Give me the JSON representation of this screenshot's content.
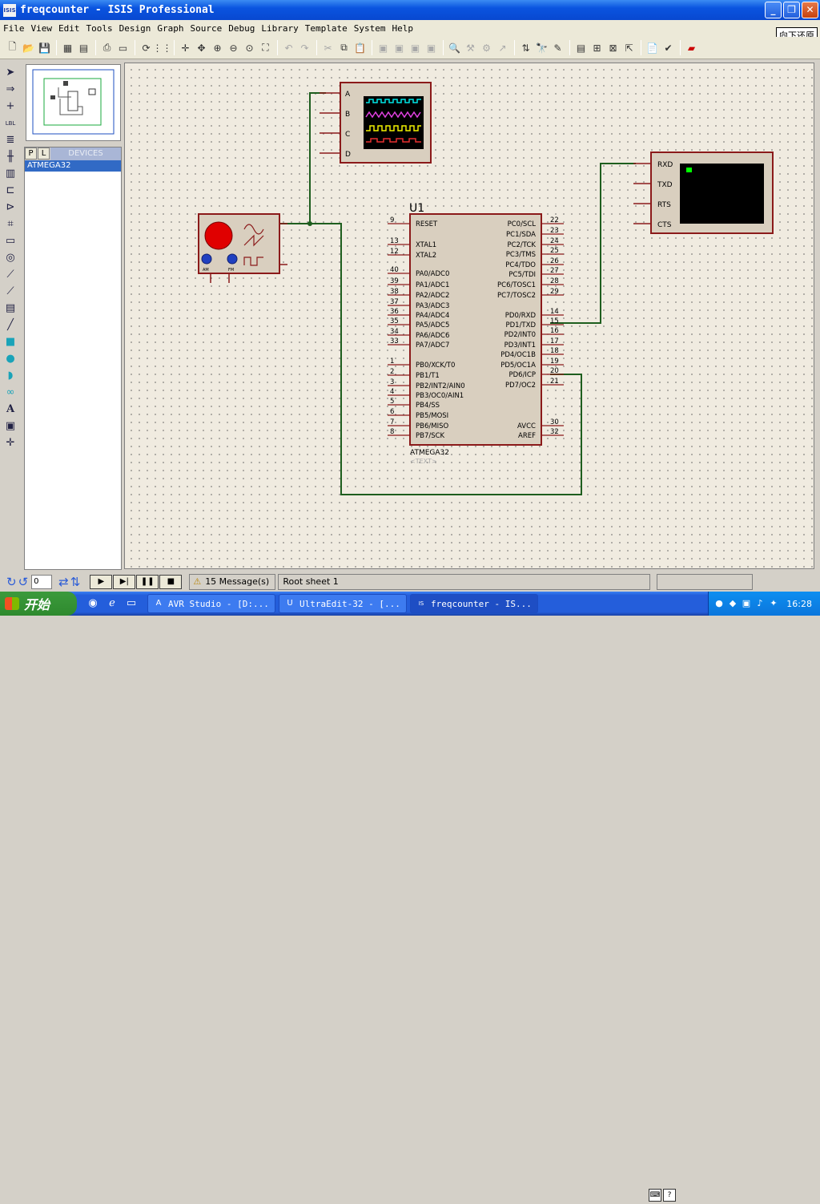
{
  "window": {
    "title": "freqcounter - ISIS Professional",
    "app_icon_text": "ISIS",
    "min": "_",
    "max": "❐",
    "close": "✕"
  },
  "menu": {
    "items": [
      "File",
      "View",
      "Edit",
      "Tools",
      "Design",
      "Graph",
      "Source",
      "Debug",
      "Library",
      "Template",
      "System",
      "Help"
    ],
    "tooltip": "向下还原"
  },
  "devices": {
    "tab_p": "P",
    "tab_l": "L",
    "header": "DEVICES",
    "items": [
      "ATMEGA32"
    ]
  },
  "schematic": {
    "ref": "U1",
    "part": "ATMEGA32",
    "text_placeholder": "<TEXT>",
    "left_pins": [
      {
        "num": "9",
        "name": "RESET"
      },
      {
        "num": "13",
        "name": "XTAL1"
      },
      {
        "num": "12",
        "name": "XTAL2"
      },
      {
        "num": "40",
        "name": "PA0/ADC0"
      },
      {
        "num": "39",
        "name": "PA1/ADC1"
      },
      {
        "num": "38",
        "name": "PA2/ADC2"
      },
      {
        "num": "37",
        "name": "PA3/ADC3"
      },
      {
        "num": "36",
        "name": "PA4/ADC4"
      },
      {
        "num": "35",
        "name": "PA5/ADC5"
      },
      {
        "num": "34",
        "name": "PA6/ADC6"
      },
      {
        "num": "33",
        "name": "PA7/ADC7"
      },
      {
        "num": "1",
        "name": "PB0/XCK/T0"
      },
      {
        "num": "2",
        "name": "PB1/T1"
      },
      {
        "num": "3",
        "name": "PB2/INT2/AIN0"
      },
      {
        "num": "4",
        "name": "PB3/OC0/AIN1"
      },
      {
        "num": "5",
        "name": "PB4/SS"
      },
      {
        "num": "6",
        "name": "PB5/MOSI"
      },
      {
        "num": "7",
        "name": "PB6/MISO"
      },
      {
        "num": "8",
        "name": "PB7/SCK"
      }
    ],
    "right_pins": [
      {
        "num": "22",
        "name": "PC0/SCL"
      },
      {
        "num": "23",
        "name": "PC1/SDA"
      },
      {
        "num": "24",
        "name": "PC2/TCK"
      },
      {
        "num": "25",
        "name": "PC3/TMS"
      },
      {
        "num": "26",
        "name": "PC4/TDO"
      },
      {
        "num": "27",
        "name": "PC5/TDI"
      },
      {
        "num": "28",
        "name": "PC6/TOSC1"
      },
      {
        "num": "29",
        "name": "PC7/TOSC2"
      },
      {
        "num": "14",
        "name": "PD0/RXD"
      },
      {
        "num": "15",
        "name": "PD1/TXD"
      },
      {
        "num": "16",
        "name": "PD2/INT0"
      },
      {
        "num": "17",
        "name": "PD3/INT1"
      },
      {
        "num": "18",
        "name": "PD4/OC1B"
      },
      {
        "num": "19",
        "name": "PD5/OC1A"
      },
      {
        "num": "20",
        "name": "PD6/ICP"
      },
      {
        "num": "21",
        "name": "PD7/OC2"
      },
      {
        "num": "30",
        "name": "AVCC"
      },
      {
        "num": "32",
        "name": "AREF"
      }
    ],
    "oscilloscope_channels": [
      "A",
      "B",
      "C",
      "D"
    ],
    "terminal_pins": [
      "RXD",
      "TXD",
      "RTS",
      "CTS"
    ],
    "generator_knob_labels": [
      "AM",
      "FM"
    ],
    "colors": {
      "wire": "#1e5e1e",
      "component": "#8b1a1a",
      "body": "#d9cfbf",
      "trace1": "#00e5e5",
      "trace2": "#e040e0",
      "trace3": "#f0f000",
      "trace4": "#e83030"
    }
  },
  "status": {
    "rotation": "0",
    "messages": "15 Message(s)",
    "sheet": "Root sheet 1"
  },
  "taskbar": {
    "start": "开始",
    "tasks": [
      {
        "label": "AVR Studio - [D:...",
        "icon": "A"
      },
      {
        "label": "UltraEdit-32 - [...",
        "icon": "U"
      },
      {
        "label": "freqcounter - IS...",
        "icon": "IS"
      }
    ],
    "clock": "16:28"
  }
}
